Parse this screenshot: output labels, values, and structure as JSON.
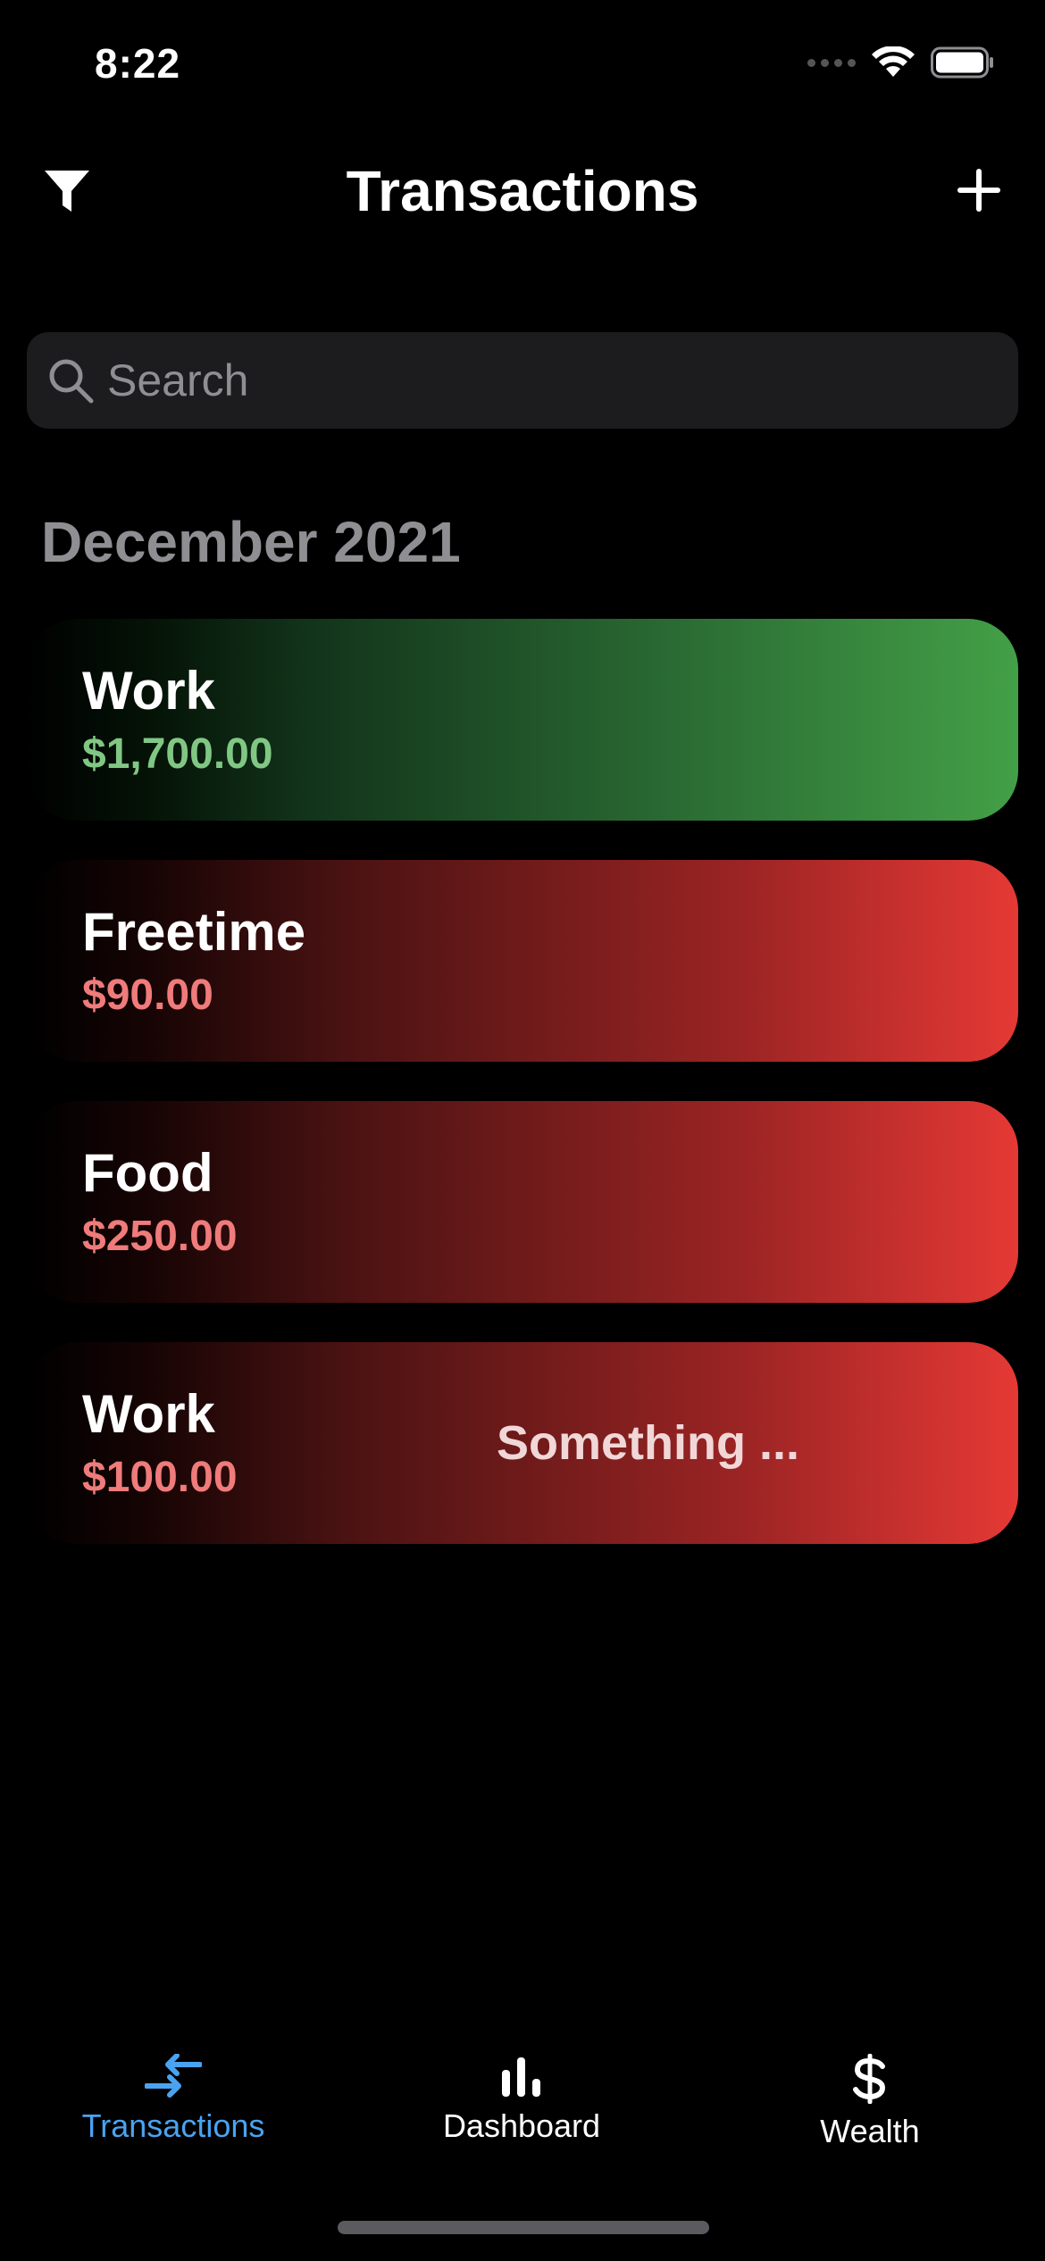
{
  "status_bar": {
    "time": "8:22"
  },
  "nav": {
    "title": "Transactions"
  },
  "search": {
    "placeholder": "Search"
  },
  "section": {
    "header": "December 2021"
  },
  "transactions": [
    {
      "category": "Work",
      "amount": "$1,700.00",
      "type": "income",
      "note": ""
    },
    {
      "category": "Freetime",
      "amount": "$90.00",
      "type": "expense",
      "note": ""
    },
    {
      "category": "Food",
      "amount": "$250.00",
      "type": "expense",
      "note": ""
    },
    {
      "category": "Work",
      "amount": "$100.00",
      "type": "expense",
      "note": "Something ..."
    }
  ],
  "tabbar": {
    "tabs": [
      {
        "label": "Transactions",
        "icon": "arrows-swap-icon",
        "active": true
      },
      {
        "label": "Dashboard",
        "icon": "bar-chart-icon",
        "active": false
      },
      {
        "label": "Wealth",
        "icon": "dollar-icon",
        "active": false
      }
    ]
  },
  "colors": {
    "background": "#000000",
    "income": "#43a047",
    "expense": "#e53935",
    "accent": "#4aa3f0",
    "secondary_text": "#8e8e93"
  }
}
